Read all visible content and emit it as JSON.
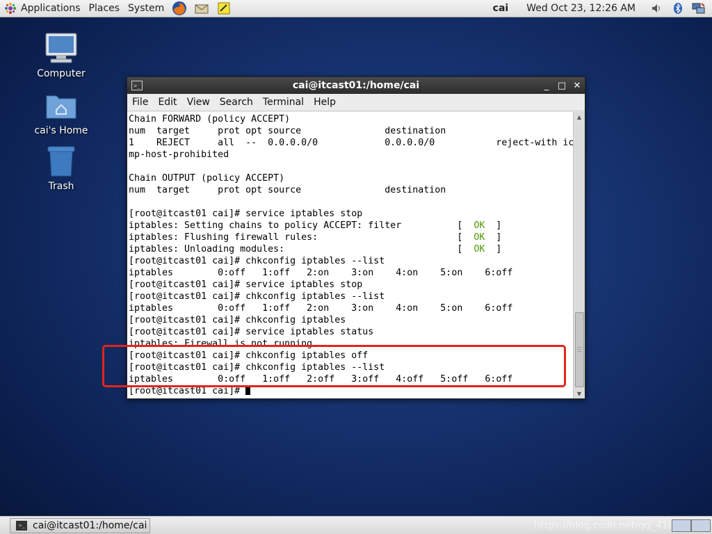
{
  "top_panel": {
    "menus": [
      "Applications",
      "Places",
      "System"
    ],
    "user": "cai",
    "clock": "Wed Oct 23, 12:26 AM"
  },
  "desktop": {
    "icons": [
      {
        "label": "Computer"
      },
      {
        "label": "cai's Home"
      },
      {
        "label": "Trash"
      }
    ]
  },
  "terminal": {
    "title": "cai@itcast01:/home/cai",
    "menu": [
      "File",
      "Edit",
      "View",
      "Search",
      "Terminal",
      "Help"
    ],
    "lines": [
      "Chain FORWARD (policy ACCEPT)",
      "num  target     prot opt source               destination",
      "1    REJECT     all  --  0.0.0.0/0            0.0.0.0/0           reject-with ic",
      "mp-host-prohibited",
      "",
      "Chain OUTPUT (policy ACCEPT)",
      "num  target     prot opt source               destination",
      "",
      "[root@itcast01 cai]# service iptables stop",
      "iptables: Setting chains to policy ACCEPT: filter          [  OK  ]",
      "iptables: Flushing firewall rules:                         [  OK  ]",
      "iptables: Unloading modules:                               [  OK  ]",
      "[root@itcast01 cai]# chkconfig iptables --list",
      "iptables        0:off   1:off   2:on    3:on    4:on    5:on    6:off",
      "[root@itcast01 cai]# service iptables stop",
      "[root@itcast01 cai]# chkconfig iptables --list",
      "iptables        0:off   1:off   2:on    3:on    4:on    5:on    6:off",
      "[root@itcast01 cai]# chkconfig iptables",
      "[root@itcast01 cai]# service iptables status",
      "iptables: Firewall is not running.",
      "[root@itcast01 cai]# chkconfig iptables off",
      "[root@itcast01 cai]# chkconfig iptables --list",
      "iptables        0:off   1:off   2:off   3:off   4:off   5:off   6:off",
      "[root@itcast01 cai]# "
    ],
    "ok_text": "OK"
  },
  "taskbar": {
    "window_button": "cai@itcast01:/home/cai"
  },
  "watermark": "https://blog.csdn.net/qq_41615000"
}
